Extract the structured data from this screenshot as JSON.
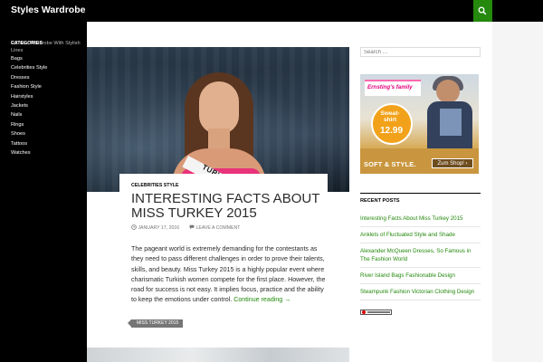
{
  "site": {
    "title": "Styles Wardrobe",
    "tagline": "Fill Your Wardrobe With Stylish Lines"
  },
  "sidebar": {
    "categories_heading": "CATEGORIES",
    "categories": [
      "Bags",
      "Celebrities Style",
      "Dresses",
      "Fashion Style",
      "Hairstyles",
      "Jackets",
      "Nails",
      "Rings",
      "Shoes",
      "Tattoos",
      "Watches"
    ]
  },
  "post": {
    "category": "CELEBRITIES STYLE",
    "title": "INTERESTING FACTS ABOUT MISS TURKEY 2015",
    "date": "JANUARY 17, 2016",
    "comment_link": "LEAVE A COMMENT",
    "body": "The pageant world is extremely demanding for the contestants as they need to pass different challenges in order to prove their talents, skills, and beauty. Miss Turkey 2015 is a highly popular event where charismatic Turkish women compete for the first place. However, the road for success is not easy. It implies focus, practice and the ability to keep the emotions under control.",
    "continue_link": "Continue reading →",
    "tag": "MISS TURKEY 2015",
    "image_sash_text": "TURKEY"
  },
  "widgets": {
    "search_placeholder": "Search …",
    "ad": {
      "brand": "Ernsting's family",
      "badge_line1": "Sweat-shirt",
      "badge_price": "12.99",
      "slogan": "SOFT & STYLE.",
      "cta": "Zum Shop! ›"
    },
    "recent_posts_heading": "RECENT POSTS",
    "recent_posts": [
      "Interesting Facts About Miss Turkey 2015",
      "Anklets of Fluctuated Style and Shade",
      "Alexander McQueen Dresses, So Famous in The Fashion World",
      "River Island Bags Fashionable Design",
      "Steampunk Fashion Victorian Clothing Design"
    ]
  },
  "colors": {
    "accent_green": "#24890d",
    "header_black": "#000000",
    "tag_gray": "#767676"
  },
  "icons": {
    "search": "search-icon",
    "date": "clock-icon",
    "comment": "comment-icon"
  }
}
